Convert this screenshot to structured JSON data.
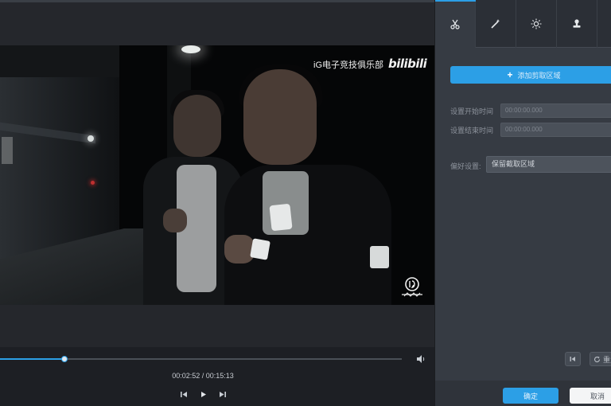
{
  "player": {
    "watermark_text": "iG电子竞技俱乐部",
    "watermark_logo": "bilibili",
    "time_current": "00:02:52",
    "time_total": "00:15:13",
    "time_separator": " / ",
    "progress_fraction": 0.16
  },
  "tabs": [
    {
      "icon": "scissors-icon",
      "active": true
    },
    {
      "icon": "magic-wand-icon",
      "active": false
    },
    {
      "icon": "brightness-icon",
      "active": false
    },
    {
      "icon": "stamp-icon",
      "active": false
    }
  ],
  "panel": {
    "add_region_label": "添加剪取区域",
    "set_start_label": "设置开始时间",
    "set_start_value": "00:00:00.000",
    "set_end_label": "设置结束时间",
    "set_end_value": "00:00:00.000",
    "mode_label": "偏好设置:",
    "mode_value": "保留截取区域",
    "reset_label": "重置"
  },
  "footer": {
    "ok_label": "确定",
    "cancel_label": "取消"
  },
  "colors": {
    "accent": "#2c9fe6",
    "panel_bg": "#363b43",
    "player_bg": "#25272c"
  }
}
